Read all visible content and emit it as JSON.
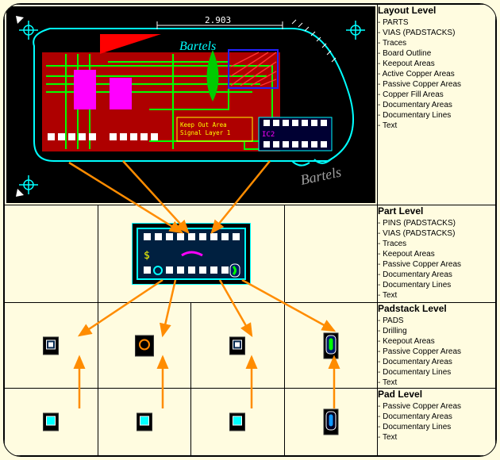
{
  "layout_level": {
    "title": "Layout Level",
    "items": [
      "PARTS",
      "VIAS (PADSTACKS)",
      "Traces",
      "Board Outline",
      "Keepout Areas",
      "Active Copper Areas",
      "Passive Copper Areas",
      "Copper Fill Areas",
      "Documentary Areas",
      "Documentary Lines",
      "Text"
    ]
  },
  "part_level": {
    "title": "Part Level",
    "items": [
      "PINS (PADSTACKS)",
      "VIAS (PADSTACKS)",
      "Traces",
      "Keepout Areas",
      "Passive Copper Areas",
      "Documentary Areas",
      "Documentary Lines",
      "Text"
    ]
  },
  "padstack_level": {
    "title": "Padstack Level",
    "items": [
      "PADS",
      "Drilling",
      "Keepout Areas",
      "Passive Copper Areas",
      "Documentary Areas",
      "Documentary Lines",
      "Text"
    ]
  },
  "pad_level": {
    "title": "Pad Level",
    "items": [
      "Passive Copper Areas",
      "Documentary Areas",
      "Documentary Lines",
      "Text"
    ]
  },
  "pcb": {
    "dim_label": "2.903",
    "brand_top": "Bartels",
    "brand_bottom": "Bartels",
    "keepout_line1": "Keep Out Area",
    "keepout_line2": "Signal Layer 1",
    "ic_label": "IC2",
    "dollar": "$"
  }
}
